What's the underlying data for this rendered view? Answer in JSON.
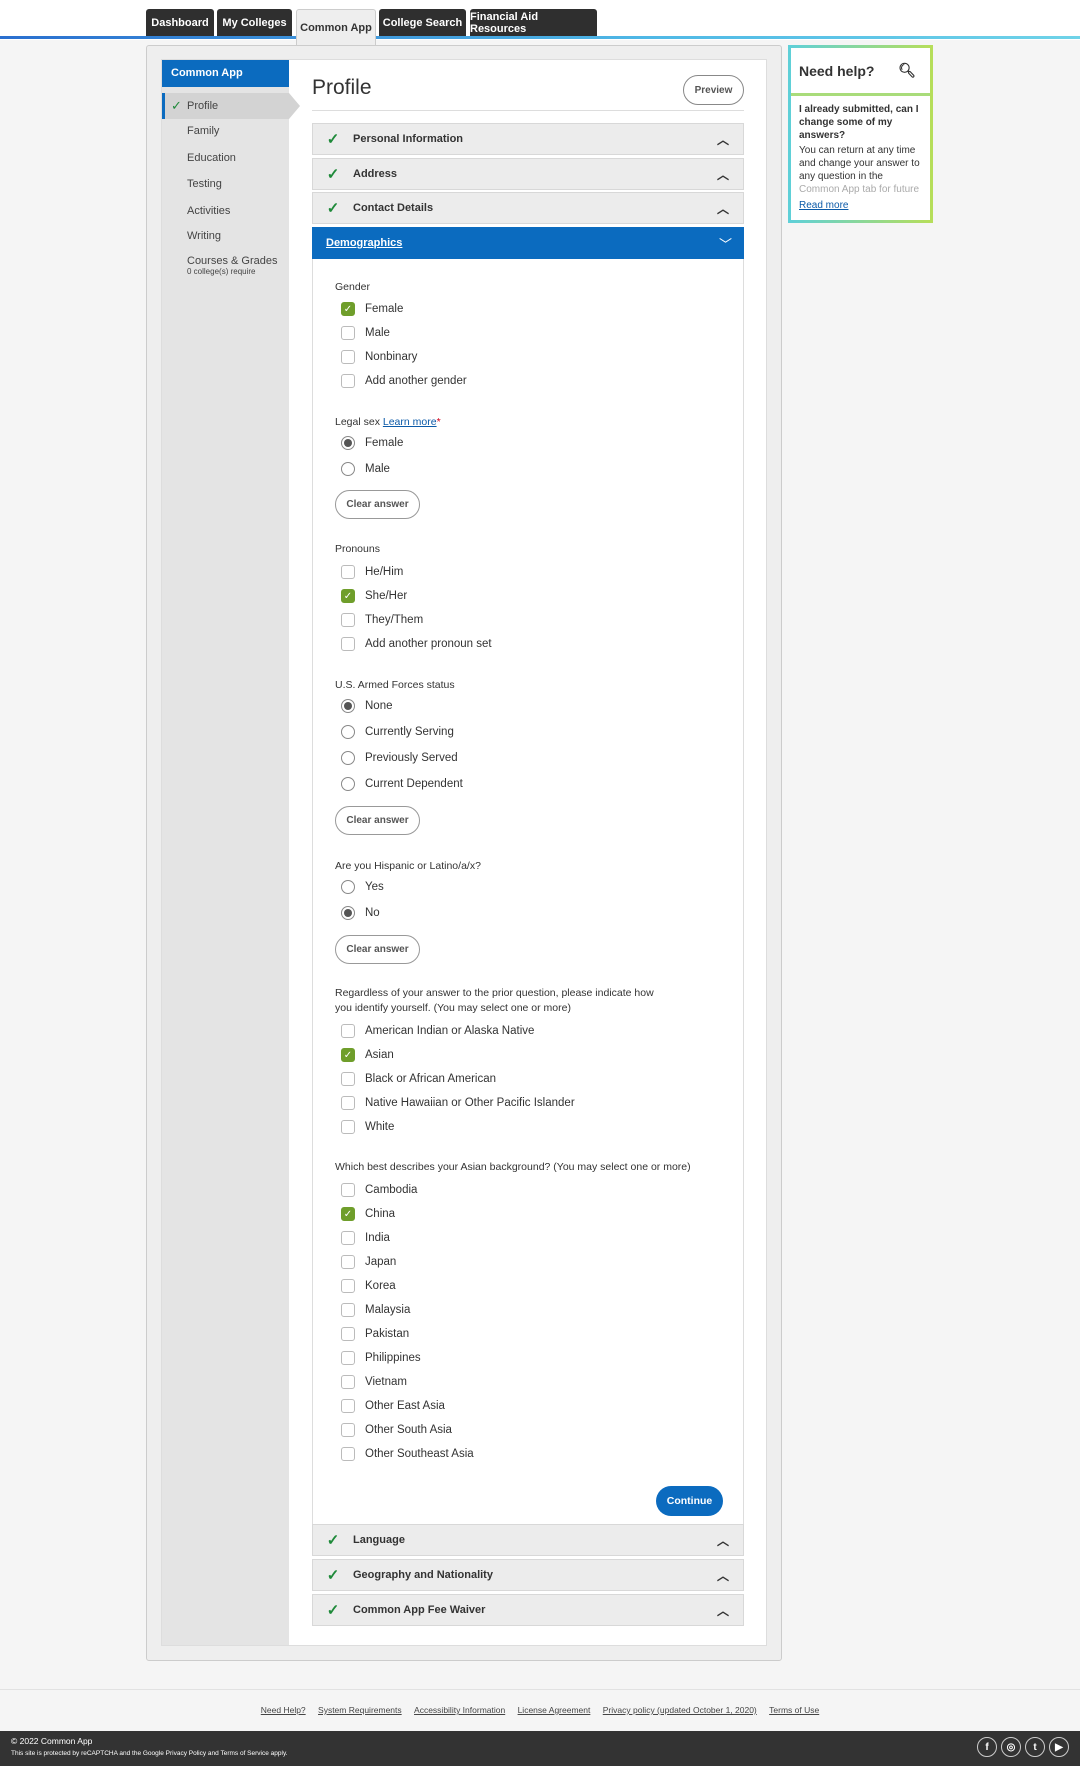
{
  "tabs": [
    "Dashboard",
    "My Colleges",
    "Common App",
    "College Search",
    "Financial Aid Resources"
  ],
  "sidebar": {
    "header": "Common App",
    "items": [
      "Profile",
      "Family",
      "Education",
      "Testing",
      "Activities",
      "Writing",
      "Courses & Grades"
    ],
    "courses_sub": "0 college(s) require"
  },
  "page": {
    "title": "Profile",
    "preview": "Preview"
  },
  "sections_top": [
    "Personal Information",
    "Address",
    "Contact Details"
  ],
  "demographics": "Demographics",
  "gender": {
    "label": "Gender",
    "options": [
      "Female",
      "Male",
      "Nonbinary",
      "Add another gender"
    ],
    "checked": [
      true,
      false,
      false,
      false
    ]
  },
  "legal_sex": {
    "label": "Legal sex ",
    "learn_more": "Learn more",
    "required": "*",
    "options": [
      "Female",
      "Male"
    ],
    "selected": 0
  },
  "clear_answer": "Clear answer",
  "pronouns": {
    "label": "Pronouns",
    "options": [
      "He/Him",
      "She/Her",
      "They/Them",
      "Add another pronoun set"
    ],
    "checked": [
      false,
      true,
      false,
      false
    ]
  },
  "armed": {
    "label": "U.S. Armed Forces status",
    "options": [
      "None",
      "Currently Serving",
      "Previously Served",
      "Current Dependent"
    ],
    "selected": 0
  },
  "hispanic": {
    "label": "Are you Hispanic or Latino/a/x?",
    "options": [
      "Yes",
      "No"
    ],
    "selected": 1
  },
  "race": {
    "label": "Regardless of your answer to the prior question, please indicate how you identify yourself. (You may select one or more)",
    "options": [
      "American Indian or Alaska Native",
      "Asian",
      "Black or African American",
      "Native Hawaiian or Other Pacific Islander",
      "White"
    ],
    "checked": [
      false,
      true,
      false,
      false,
      false
    ]
  },
  "asian": {
    "label": "Which best describes your Asian background? (You may select one or more)",
    "options": [
      "Cambodia",
      "China",
      "India",
      "Japan",
      "Korea",
      "Malaysia",
      "Pakistan",
      "Philippines",
      "Vietnam",
      "Other East Asia",
      "Other South Asia",
      "Other Southeast Asia"
    ],
    "checked": [
      false,
      true,
      false,
      false,
      false,
      false,
      false,
      false,
      false,
      false,
      false,
      false
    ]
  },
  "continue": "Continue",
  "sections_bottom": [
    "Language",
    "Geography and Nationality",
    "Common App Fee Waiver"
  ],
  "help": {
    "title": "Need help?",
    "question": "I already submitted, can I change some of my answers?",
    "answer": "You can return at any time and change your answer to any question in the",
    "answer_faded": "Common App tab for future",
    "read_more": "Read more"
  },
  "footer": {
    "links": [
      "Need Help?",
      "System Requirements",
      "Accessibility Information",
      "License Agreement",
      "Privacy policy (updated October 1, 2020)",
      "Terms of Use"
    ],
    "copyright": "© 2022 Common App",
    "recaptcha_pre": "This site is protected by reCAPTCHA and the Google ",
    "privacy": "Privacy Policy",
    "and": " and ",
    "terms": "Terms of Service",
    "apply": " apply.",
    "social": [
      "facebook",
      "instagram",
      "twitter",
      "youtube"
    ]
  },
  "colors": {
    "accent": "#0b6bbf",
    "check_green": "#6f9e2b",
    "complete_green": "#1f8a3a"
  }
}
